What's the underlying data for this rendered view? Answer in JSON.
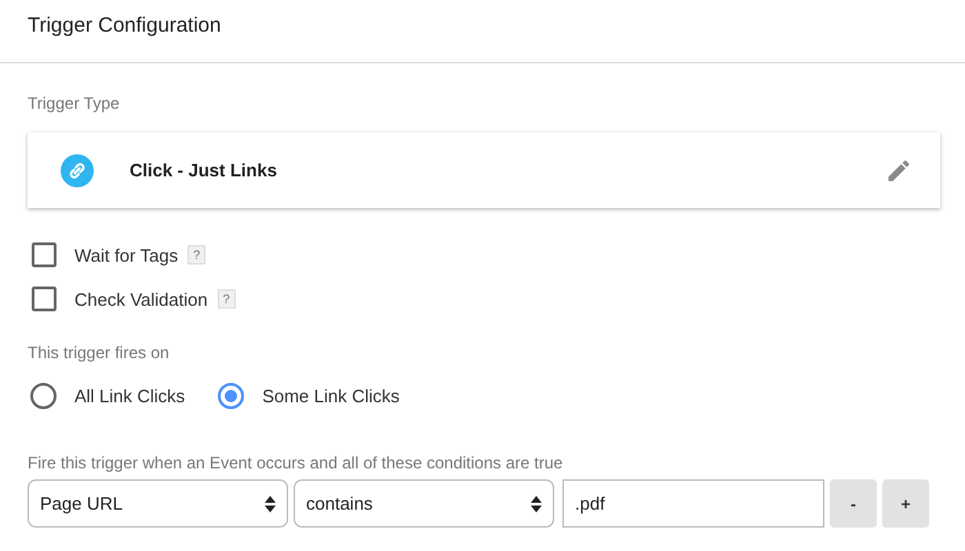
{
  "header": {
    "title": "Trigger Configuration"
  },
  "trigger_type": {
    "label": "Trigger Type",
    "name": "Click - Just Links"
  },
  "options": [
    {
      "label": "Wait for Tags",
      "help": "?",
      "checked": false
    },
    {
      "label": "Check Validation",
      "help": "?",
      "checked": false
    }
  ],
  "fires_on": {
    "label": "This trigger fires on",
    "choices": [
      {
        "label": "All Link Clicks",
        "selected": false
      },
      {
        "label": "Some Link Clicks",
        "selected": true
      }
    ]
  },
  "conditions": {
    "label": "Fire this trigger when an Event occurs and all of these conditions are true",
    "variable": "Page URL",
    "operator": "contains",
    "value": ".pdf",
    "buttons": [
      "-",
      "+"
    ]
  }
}
